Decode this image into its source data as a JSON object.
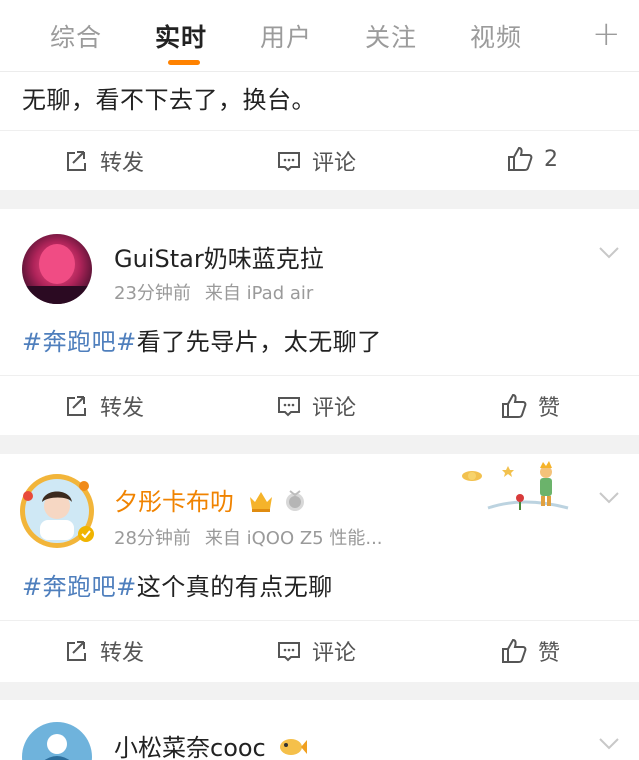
{
  "tabs": [
    {
      "label": "综合"
    },
    {
      "label": "实时"
    },
    {
      "label": "用户"
    },
    {
      "label": "关注"
    },
    {
      "label": "视频"
    }
  ],
  "tabs_plus": "+",
  "accent": "#ff8200",
  "topic_color": "#4f7fbd",
  "posts": [
    {
      "text": "无聊，看不下去了，换台。",
      "repost_label": "转发",
      "comment_label": "评论",
      "like_label": "2"
    },
    {
      "user": "GuiStar奶味蓝克拉",
      "time": "23分钟前",
      "source": "来自 iPad air",
      "topic": "#奔跑吧#",
      "text": "看了先导片，太无聊了",
      "repost_label": "转发",
      "comment_label": "评论",
      "like_label": "赞"
    },
    {
      "user": "夕彤卡布叻",
      "time": "28分钟前",
      "source": "来自 iQOO Z5 性能...",
      "topic": "#奔跑吧#",
      "text": "这个真的有点无聊",
      "repost_label": "转发",
      "comment_label": "评论",
      "like_label": "赞"
    },
    {
      "user": "小松菜奈cooc"
    }
  ]
}
